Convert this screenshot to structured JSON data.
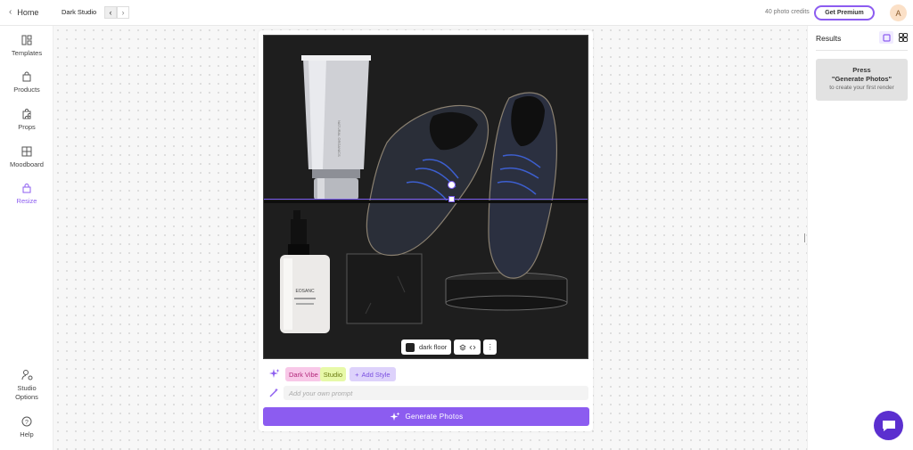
{
  "topbar": {
    "home_label": "Home",
    "project_name": "Dark Studio",
    "credits": "40 photo credits",
    "premium_label": "Get Premium",
    "avatar_initial": "A"
  },
  "sidebar": {
    "items": [
      {
        "label": "Templates",
        "icon": "templates-icon"
      },
      {
        "label": "Products",
        "icon": "bag-icon"
      },
      {
        "label": "Props",
        "icon": "puzzle-icon"
      },
      {
        "label": "Moodboard",
        "icon": "moodboard-icon"
      },
      {
        "label": "Resize",
        "icon": "lock-icon",
        "active": true
      }
    ],
    "bottom": [
      {
        "label": "Studio Options",
        "icon": "studio-options-icon"
      },
      {
        "label": "Help",
        "icon": "help-icon"
      }
    ]
  },
  "editor": {
    "tube_brand": "NATURAL ORGANICS",
    "bottle_brand": "EOSANC",
    "floor_label": "dark floor",
    "styles": [
      "Dark Vibe",
      "Studio"
    ],
    "add_style_label": "Add Style",
    "prompt_placeholder": "Add your own prompt",
    "generate_label": "Generate Photos"
  },
  "results": {
    "title": "Results",
    "empty_line1": "Press",
    "empty_line2": "\"Generate Photos\"",
    "empty_line3": "to create your first render"
  },
  "colors": {
    "accent": "#8c5cf0",
    "photo_bg": "#1e1e1e",
    "chat": "#5b2fcf"
  }
}
